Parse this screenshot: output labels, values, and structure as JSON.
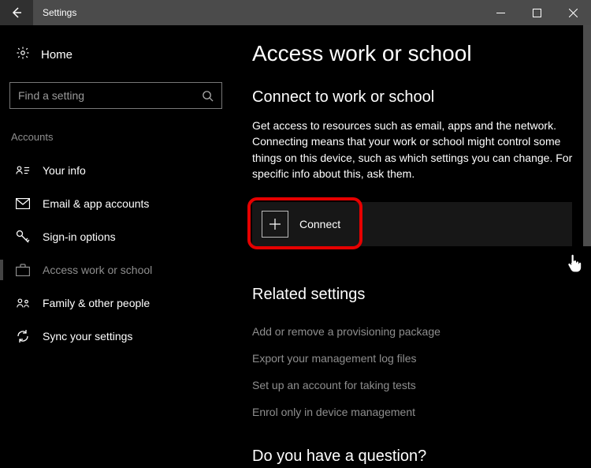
{
  "titlebar": {
    "title": "Settings"
  },
  "sidebar": {
    "home_label": "Home",
    "search_placeholder": "Find a setting",
    "group_label": "Accounts",
    "items": [
      {
        "label": "Your info"
      },
      {
        "label": "Email & app accounts"
      },
      {
        "label": "Sign-in options"
      },
      {
        "label": "Access work or school"
      },
      {
        "label": "Family & other people"
      },
      {
        "label": "Sync your settings"
      }
    ]
  },
  "main": {
    "heading": "Access work or school",
    "subheading": "Connect to work or school",
    "description": "Get access to resources such as email, apps and the network. Connecting means that your work or school might control some things on this device, such as which settings you can change. For specific info about this, ask them.",
    "connect_label": "Connect",
    "related_heading": "Related settings",
    "related_links": [
      "Add or remove a provisioning package",
      "Export your management log files",
      "Set up an account for taking tests",
      "Enrol only in device management"
    ],
    "question_heading": "Do you have a question?"
  }
}
